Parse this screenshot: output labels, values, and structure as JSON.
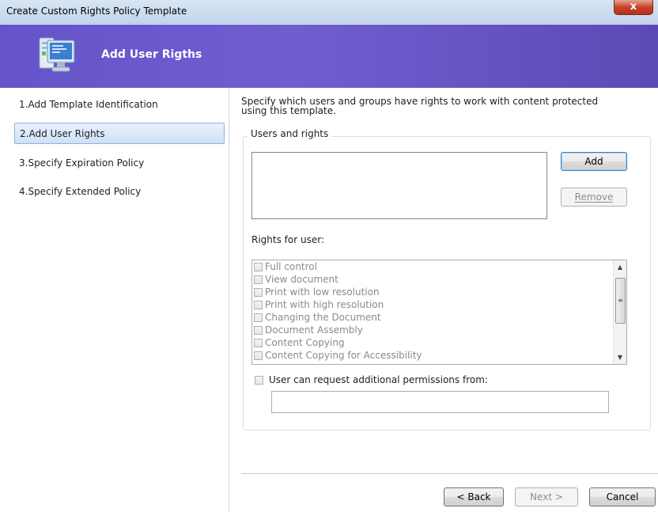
{
  "window": {
    "title": "Create Custom Rights Policy Template",
    "close_label": "x"
  },
  "banner": {
    "title": "Add User Rigths",
    "icon": "computer-monitor-icon"
  },
  "steps": [
    {
      "label": "1.Add Template Identification",
      "active": false
    },
    {
      "label": "2.Add User Rights",
      "active": true
    },
    {
      "label": "3.Specify Expiration Policy",
      "active": false
    },
    {
      "label": "4.Specify Extended Policy",
      "active": false
    }
  ],
  "main": {
    "description_line1": "Specify which users and groups have rights to work with content protected",
    "description_line2": "using this template.",
    "group_title": "Users and rights",
    "add_label": "Add",
    "remove_label": "Remove",
    "rights_label": "Rights for user:",
    "rights": [
      "Full control",
      "View document",
      "Print with low resolution",
      "Print with high resolution",
      "Changing the Document",
      "Document Assembly",
      "Content Copying",
      "Content Copying for Accessibility"
    ],
    "request_label": "User can request additional permissions from:",
    "request_value": ""
  },
  "footer": {
    "back_label": "< Back",
    "next_label": "Next >",
    "cancel_label": "Cancel"
  },
  "colors": {
    "banner": "#6554c9",
    "active_step": "#cfe0f6",
    "disabled_text": "#8a8a8a"
  }
}
